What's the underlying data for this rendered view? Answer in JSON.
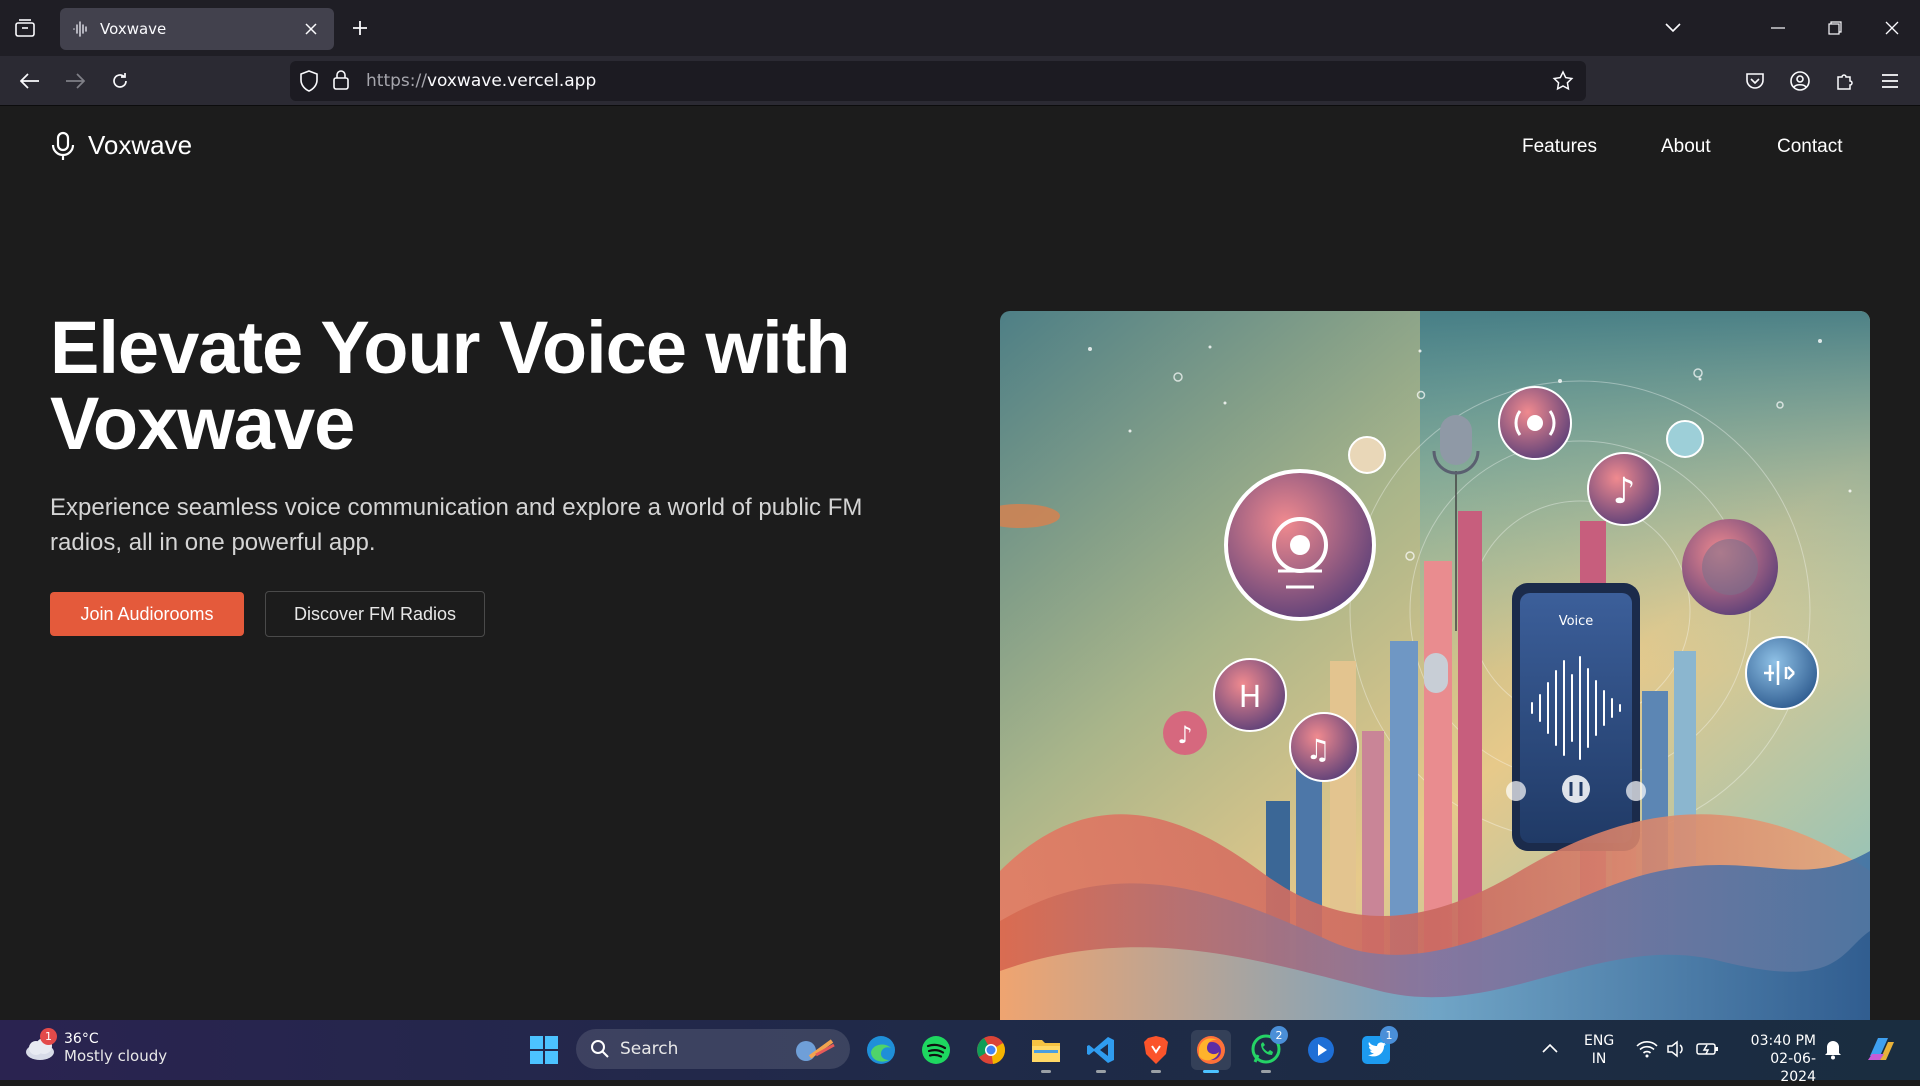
{
  "browser": {
    "tab_title": "Voxwave",
    "url_scheme": "https://",
    "url_host": "voxwave.vercel.app"
  },
  "site": {
    "brand": "Voxwave",
    "nav": [
      "Features",
      "About",
      "Contact"
    ],
    "hero_title_line1": "Elevate Your Voice with",
    "hero_title_line2": "Voxwave",
    "hero_subtitle": "Experience seamless voice communication and explore a world of public FM radios, all in one powerful app.",
    "primary_button": "Join Audiorooms",
    "secondary_button": "Discover FM Radios",
    "hero_image_text": "Voice",
    "accent_color": "#e45a3b"
  },
  "taskbar": {
    "weather_badge": "1",
    "temperature": "36°C",
    "condition": "Mostly cloudy",
    "search_label": "Search",
    "whatsapp_badge": "2",
    "twitter_badge": "1",
    "lang_line1": "ENG",
    "lang_line2": "IN",
    "time": "03:40 PM",
    "date": "02-06-2024"
  }
}
